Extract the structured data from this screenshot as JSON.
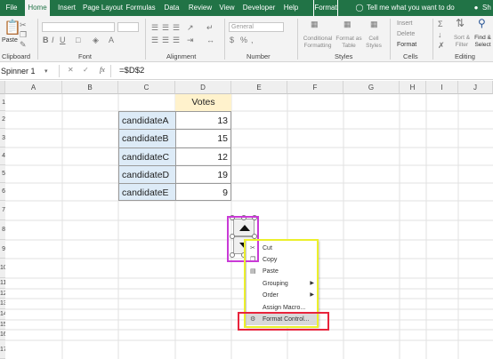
{
  "ribbon_tabs": [
    "File",
    "Home",
    "Insert",
    "Page Layout",
    "Formulas",
    "Data",
    "Review",
    "View",
    "Developer",
    "Help",
    "Format"
  ],
  "tell_me": "Tell me what you want to do",
  "share_label": "Sh",
  "group_labels": {
    "clipboard": "Clipboard",
    "font": "Font",
    "alignment": "Alignment",
    "number": "Number",
    "styles": "Styles",
    "cells": "Cells",
    "editing": "Editing"
  },
  "ribbon_text": {
    "paste": "Paste",
    "number_format": "General",
    "conditional_formatting": "Conditional Formatting",
    "format_as_table": "Format as Table",
    "cell_styles": "Cell Styles",
    "insert": "Insert",
    "delete": "Delete",
    "format": "Format",
    "sort_filter": "Sort & Filter",
    "find_select": "Find & Select"
  },
  "formula_bar": {
    "name_box": "Spinner 1",
    "fx": "fx",
    "formula": "=$D$2",
    "cancel": "✕",
    "enter": "✓"
  },
  "columns": [
    "A",
    "B",
    "C",
    "D",
    "E",
    "F",
    "G",
    "H",
    "I",
    "J"
  ],
  "rows": [
    "1",
    "2",
    "3",
    "4",
    "5",
    "6",
    "7",
    "8",
    "9",
    "10",
    "11",
    "12",
    "13",
    "14",
    "15",
    "16",
    "17"
  ],
  "table": {
    "header": "Votes",
    "rows": [
      {
        "name": "candidateA",
        "votes": "13"
      },
      {
        "name": "candidateB",
        "votes": "15"
      },
      {
        "name": "candidateC",
        "votes": "12"
      },
      {
        "name": "candidateD",
        "votes": "19"
      },
      {
        "name": "candidateE",
        "votes": "9"
      }
    ]
  },
  "context_menu": [
    {
      "label": "Cut",
      "submenu": false
    },
    {
      "label": "Copy",
      "submenu": false
    },
    {
      "label": "Paste",
      "submenu": false
    },
    {
      "label": "Grouping",
      "submenu": true
    },
    {
      "label": "Order",
      "submenu": true
    },
    {
      "label": "Assign Macro...",
      "submenu": false
    },
    {
      "label": "Format Control...",
      "submenu": false
    }
  ],
  "colors": {
    "accent": "#217346",
    "magenta_box": "#c93ad6",
    "yellow_box": "#ecf02b",
    "red_box": "#e8243c",
    "header_fill": "#fff2cc",
    "label_fill": "#ddebf7"
  }
}
